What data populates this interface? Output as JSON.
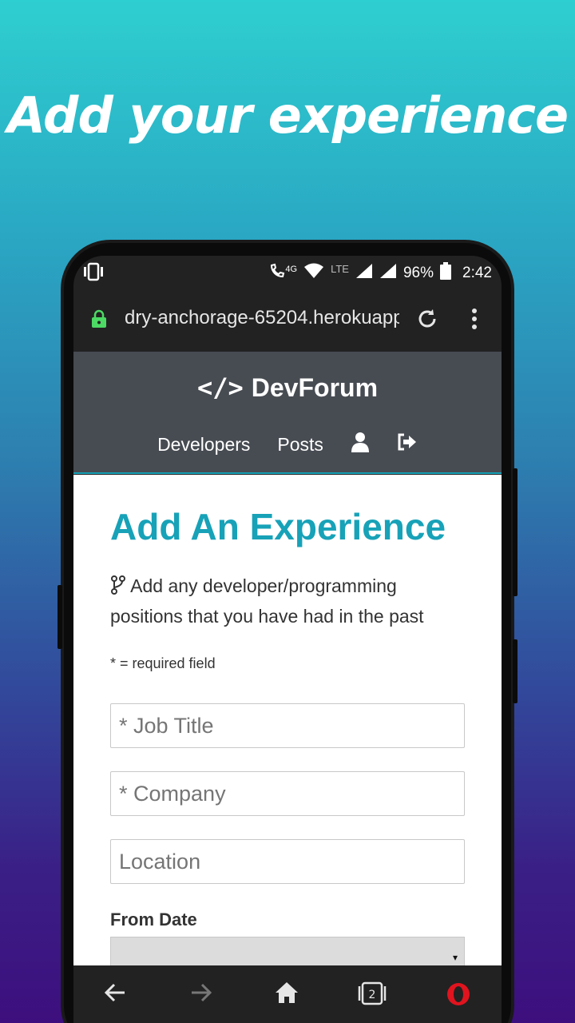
{
  "promo": {
    "title": "Add your experience"
  },
  "status_bar": {
    "network": "4G",
    "lte": "LTE",
    "battery": "96%",
    "time": "2:42"
  },
  "browser": {
    "url": "dry-anchorage-65204.herokuapp",
    "tab_count": "2"
  },
  "site": {
    "brand_code": "</>",
    "brand_name": "DevForum",
    "nav": {
      "developers": "Developers",
      "posts": "Posts"
    }
  },
  "form": {
    "heading": "Add An Experience",
    "lead": "Add any developer/programming positions that you have had in the past",
    "required_note": "* = required field",
    "job_title_placeholder": "* Job Title",
    "company_placeholder": "* Company",
    "location_placeholder": "Location",
    "from_date_label": "From Date",
    "select_arrow": "▾"
  },
  "colors": {
    "accent": "#17a2b8",
    "header_bg": "#474b52",
    "browser_bg": "#222222",
    "opera_red": "#e0141e"
  }
}
